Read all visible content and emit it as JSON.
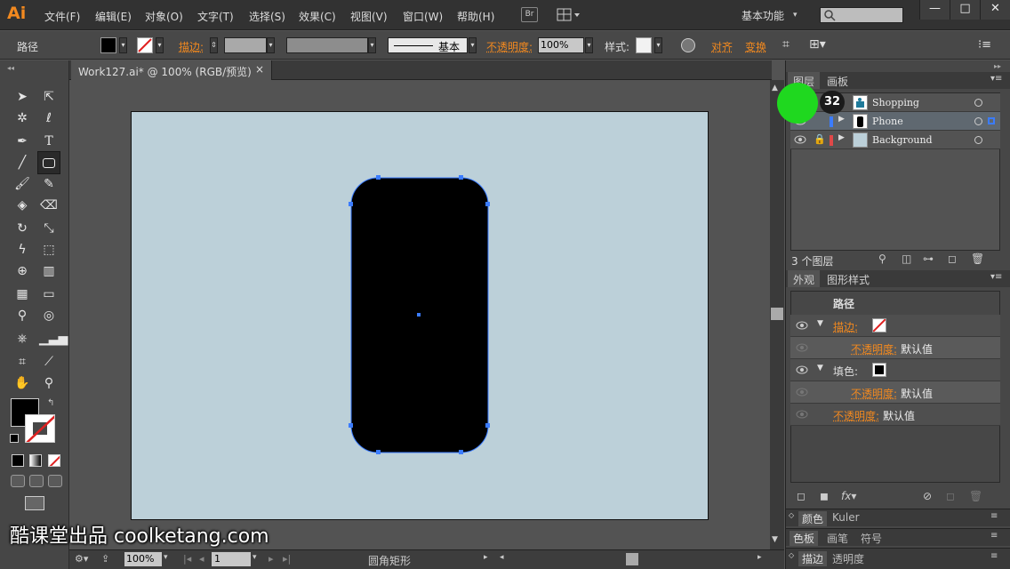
{
  "app": {
    "logo": "Ai",
    "workspace": "基本功能",
    "window_controls": [
      "—",
      "□",
      "✕"
    ]
  },
  "menu": [
    "文件(F)",
    "编辑(E)",
    "对象(O)",
    "文字(T)",
    "选择(S)",
    "效果(C)",
    "视图(V)",
    "窗口(W)",
    "帮助(H)"
  ],
  "bridge": "Br",
  "control": {
    "selection": "路径",
    "stroke_label": "描边:",
    "stroke_style": "基本",
    "opacity_label": "不透明度:",
    "opacity_value": "100%",
    "style_label": "样式:",
    "align": "对齐",
    "transform": "变换"
  },
  "document": {
    "tab_title": "Work127.ai* @ 100% (RGB/预览)",
    "close": "×"
  },
  "statusbar": {
    "zoom": "100%",
    "page": "1",
    "tool": "圆角矩形"
  },
  "layers": {
    "tabs": [
      "图层",
      "画板"
    ],
    "rows": [
      {
        "name": "Shopping",
        "color": "#3b7cff"
      },
      {
        "name": "Phone",
        "color": "#3b7cff"
      },
      {
        "name": "Background",
        "color": "#e04848"
      }
    ],
    "count": "3 个图层"
  },
  "appearance": {
    "tabs": [
      "外观",
      "图形样式"
    ],
    "title": "路径",
    "stroke_label": "描边:",
    "fill_label": "填色:",
    "opacity_label": "不透明度:",
    "default_value": "默认值"
  },
  "bottom_panels": {
    "row1": [
      "颜色",
      "Kuler"
    ],
    "row2": [
      "色板",
      "画笔",
      "符号"
    ],
    "row3": [
      "描边",
      "透明度"
    ]
  },
  "overlay": {
    "step": "32"
  },
  "watermark": "酷课堂出品 coolketang.com",
  "colors": {
    "accent": "#f2891f",
    "artboard": "#bcd0d9",
    "selection": "#3b7cff"
  }
}
